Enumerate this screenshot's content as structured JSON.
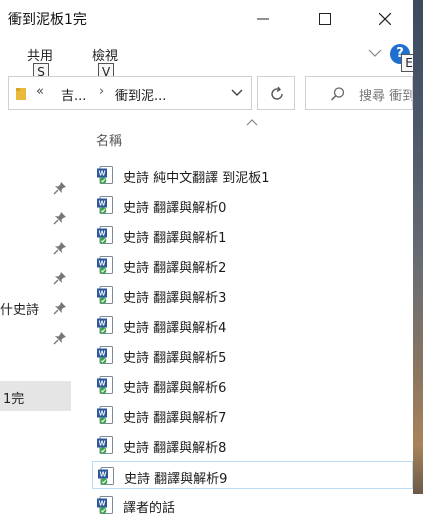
{
  "window": {
    "title": "衝到泥板1完"
  },
  "ribbon": {
    "tabs": [
      {
        "label": "共用",
        "key": "S"
      },
      {
        "label": "檢視",
        "key": "V"
      }
    ],
    "extra_key": "E",
    "help_label": "?"
  },
  "address": {
    "overflow": "«",
    "crumbs": [
      "吉...",
      "衝到泥..."
    ],
    "separator": "›"
  },
  "search": {
    "placeholder": "搜尋 衝到"
  },
  "nav": {
    "item_texts": [
      "什史詩",
      "1完"
    ]
  },
  "list": {
    "column_header": "名稱",
    "items": [
      {
        "name": "史詩 純中文翻譯 到泥板1"
      },
      {
        "name": "史詩 翻譯與解析0"
      },
      {
        "name": "史詩 翻譯與解析1"
      },
      {
        "name": "史詩 翻譯與解析2"
      },
      {
        "name": "史詩 翻譯與解析3"
      },
      {
        "name": "史詩 翻譯與解析4"
      },
      {
        "name": "史詩 翻譯與解析5"
      },
      {
        "name": "史詩 翻譯與解析6"
      },
      {
        "name": "史詩 翻譯與解析7"
      },
      {
        "name": "史詩 翻譯與解析8"
      },
      {
        "name": "史詩 翻譯與解析9",
        "selected": true
      },
      {
        "name": "譯者的話"
      }
    ]
  },
  "colors": {
    "accent": "#1f6fd1",
    "word_blue": "#2b579a",
    "check_green": "#3aa54a",
    "selection_border": "#bcdcf4"
  }
}
